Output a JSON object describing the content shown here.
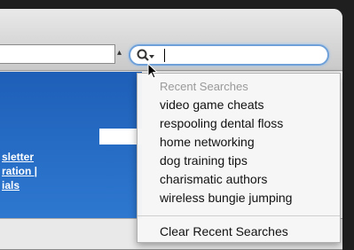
{
  "search": {
    "query": "",
    "menu": {
      "header": "Recent Searches",
      "items": [
        "video game cheats",
        "respooling dental floss",
        "home networking",
        "dog training tips",
        "charismatic authors",
        "wireless bungie jumping"
      ],
      "clear_label": "Clear Recent Searches"
    }
  },
  "page": {
    "links": [
      "sletter",
      "ration |",
      "ials"
    ]
  },
  "colors": {
    "banner": "#1e5fb8",
    "search_focus": "#6fa0d8"
  },
  "icons": [
    "magnifier-icon",
    "dropdown-arrow-icon",
    "mouse-cursor-icon"
  ]
}
